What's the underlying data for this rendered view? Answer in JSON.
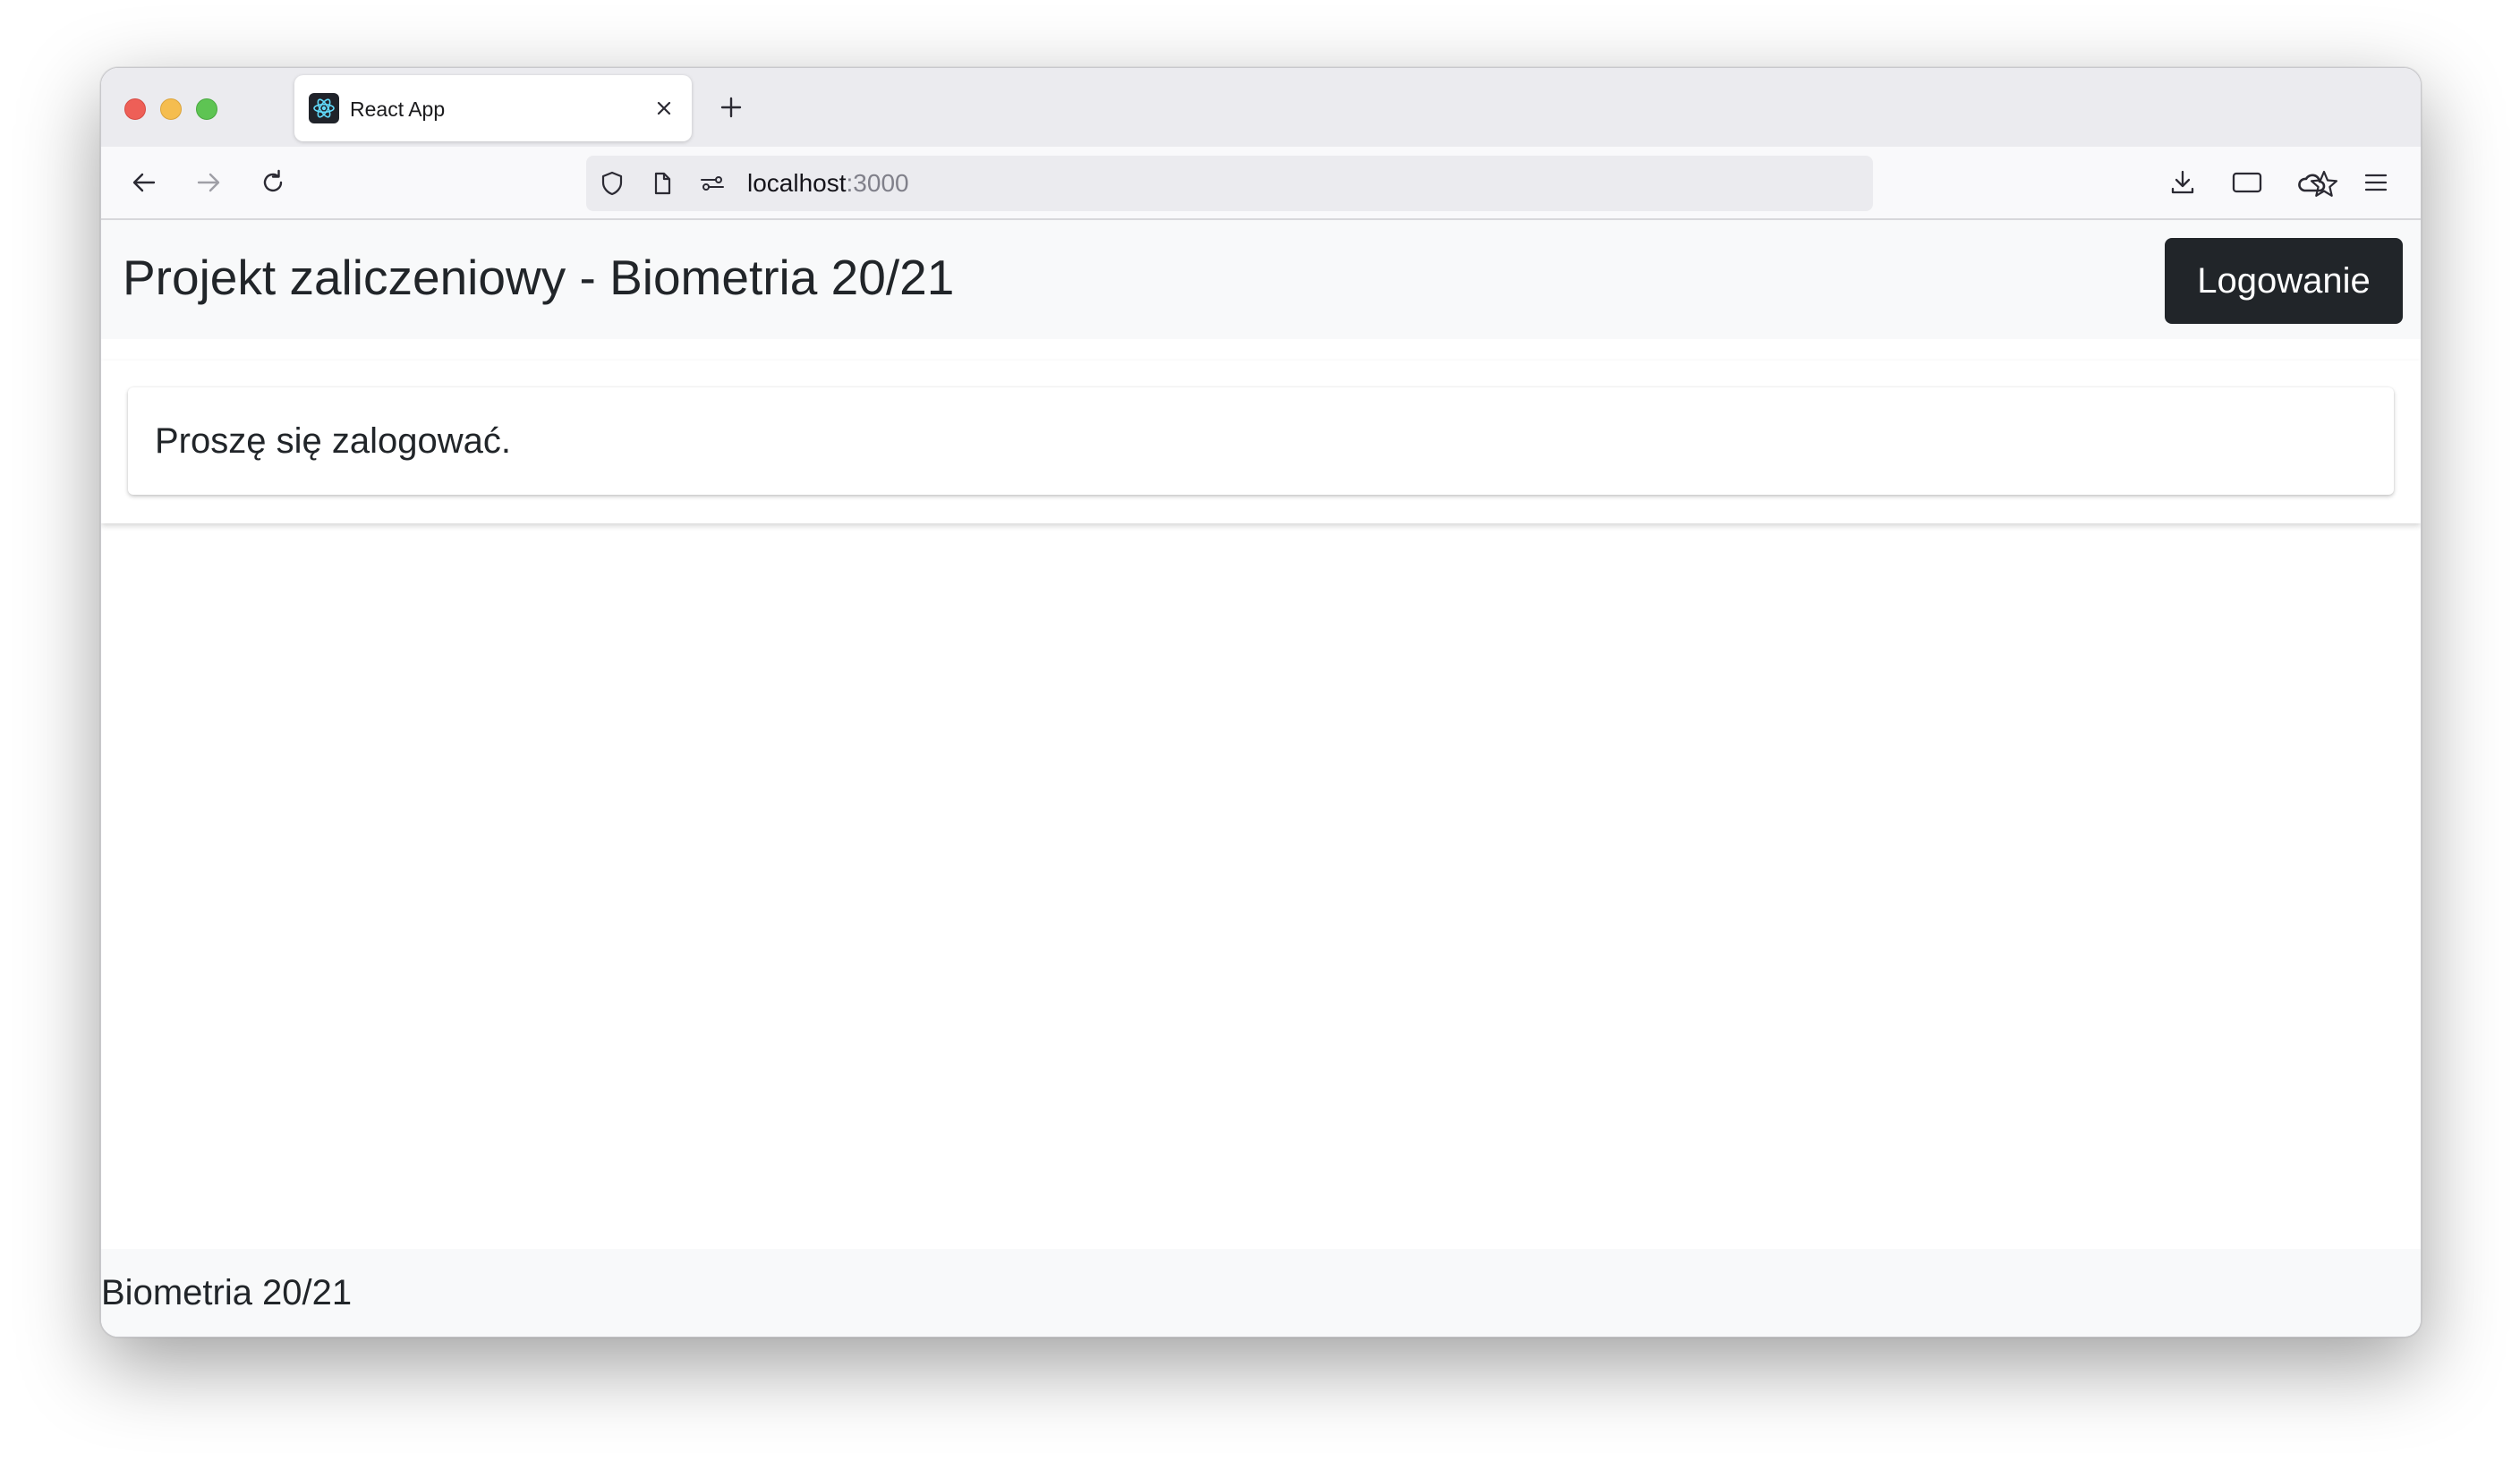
{
  "browser": {
    "tab": {
      "title": "React App",
      "favicon": "react-atom-icon"
    },
    "address": {
      "host": "localhost",
      "port": ":3000"
    },
    "toolbar_icons": [
      "back-arrow-icon",
      "forward-arrow-icon",
      "reload-icon",
      "shield-icon",
      "page-icon",
      "permissions-icon",
      "star-icon",
      "download-icon",
      "sidebar-icon",
      "account-cloud-icon",
      "menu-icon"
    ]
  },
  "app": {
    "header": {
      "title": "Projekt zaliczeniowy - Biometria 20/21",
      "login_label": "Logowanie"
    },
    "message": "Proszę się zalogować.",
    "footer": "Biometria 20/21",
    "colors": {
      "button_bg": "#212529",
      "header_bg": "#f8f9fa"
    }
  }
}
